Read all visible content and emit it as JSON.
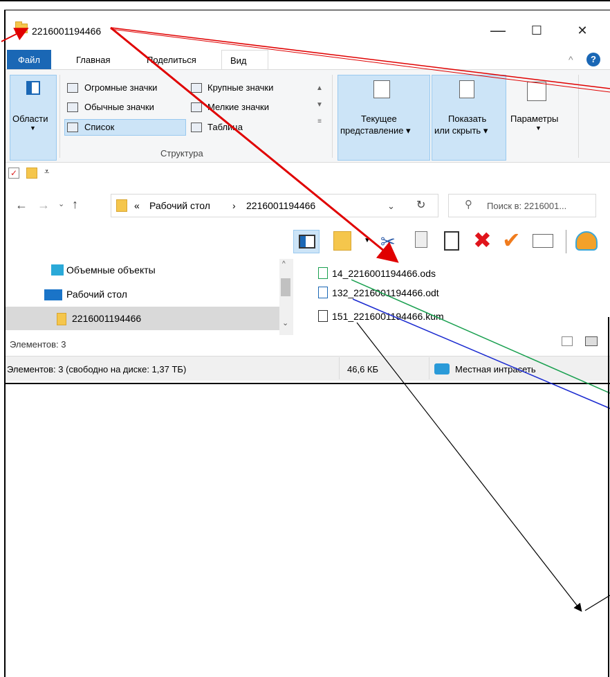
{
  "window": {
    "title": "2216001194466",
    "minimize_glyph": "—",
    "maximize_glyph": "☐",
    "close_glyph": "✕"
  },
  "ribbon": {
    "tabs": [
      {
        "label": "Файл"
      },
      {
        "label": "Главная"
      },
      {
        "label": "Поделиться"
      },
      {
        "label": "Вид"
      }
    ],
    "panes_label": "Области",
    "layout_items": [
      "Огромные значки",
      "Крупные значки",
      "Обычные значки",
      "Мелкие значки",
      "Список",
      "Таблица"
    ],
    "layout_group_label": "Структура",
    "current_view_label_1": "Текущее",
    "current_view_label_2": "представление ▾",
    "show_hide_label_1": "Показать",
    "show_hide_label_2": "или скрыть ▾",
    "options_label": "Параметры",
    "help_glyph": "?"
  },
  "address": {
    "prefix": "«",
    "crumb_1": "Рабочий стол",
    "crumb_sep": "›",
    "crumb_2": "2216001194466",
    "search_placeholder": "Поиск в: 2216001..."
  },
  "nav_pane": {
    "items": [
      {
        "label": "Объемные объекты"
      },
      {
        "label": "Рабочий стол"
      },
      {
        "label": "2216001194466"
      }
    ]
  },
  "files": [
    {
      "name": "14_2216001194466.ods",
      "kind": "spreadsheet"
    },
    {
      "name": "132_2216001194466.odt",
      "kind": "document"
    },
    {
      "name": "151_2216001194466.kum",
      "kind": "kumir"
    }
  ],
  "status": {
    "items_count": "Элементов: 3",
    "items_free": "Элементов: 3 (свободно на диске: 1,37 ТБ)",
    "size": "46,6 КБ",
    "zone": "Местная интрасеть"
  },
  "colors": {
    "file_tab": "#1a67b5",
    "selection": "#cce4f7",
    "arrow_red": "#e00000",
    "arrow_green": "#1aa050",
    "arrow_blue": "#1a2ad0",
    "arrow_black": "#000000"
  }
}
